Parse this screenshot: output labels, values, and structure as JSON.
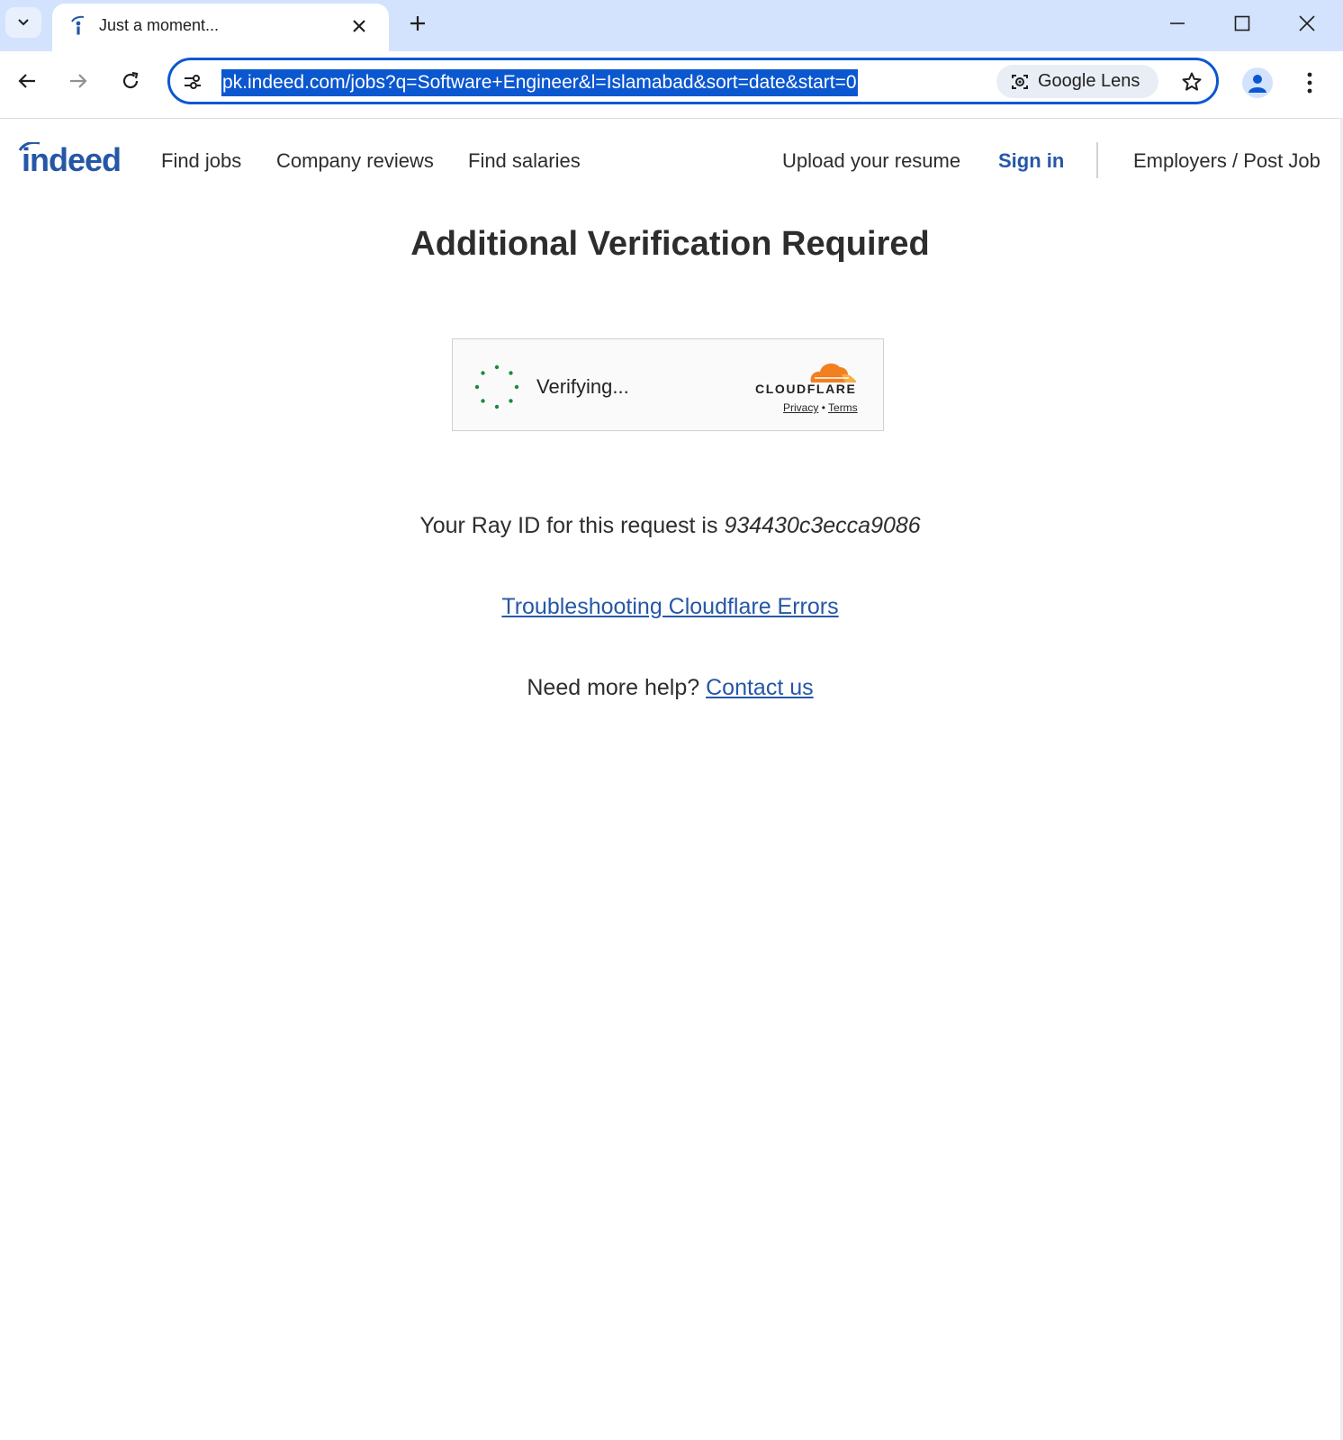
{
  "browser": {
    "tab": {
      "title": "Just a moment..."
    },
    "address_bar": {
      "url": "pk.indeed.com/jobs?q=Software+Engineer&l=Islamabad&sort=date&start=0"
    },
    "lens": {
      "label": "Google Lens"
    },
    "accent_color": "#0b57d0",
    "icons": [
      "tab-list-icon",
      "indeed-favicon",
      "close-icon",
      "plus-icon",
      "minimize-icon",
      "maximize-icon",
      "close-window-icon",
      "back-arrow-icon",
      "forward-arrow-icon",
      "reload-icon",
      "site-info-icon",
      "camera-lens-icon",
      "star-icon",
      "person-icon",
      "kebab-menu-icon"
    ]
  },
  "site": {
    "logo": "indeed",
    "brand_color": "#2557a7",
    "nav": {
      "find_jobs": "Find jobs",
      "company_reviews": "Company reviews",
      "find_salaries": "Find salaries",
      "upload_resume": "Upload your resume",
      "sign_in": "Sign in",
      "employers": "Employers / Post Job"
    }
  },
  "main": {
    "heading": "Additional Verification Required",
    "widget": {
      "status": "Verifying...",
      "brand": "CLOUDFLARE",
      "privacy": "Privacy",
      "separator": "•",
      "terms": "Terms",
      "spinner_color": "#1a8a3b"
    },
    "ray_text": "Your Ray ID for this request is",
    "ray_id": "934430c3ecca9086",
    "troubleshooting_link": "Troubleshooting Cloudflare Errors",
    "help_text": "Need more help?",
    "contact_link": "Contact us"
  }
}
